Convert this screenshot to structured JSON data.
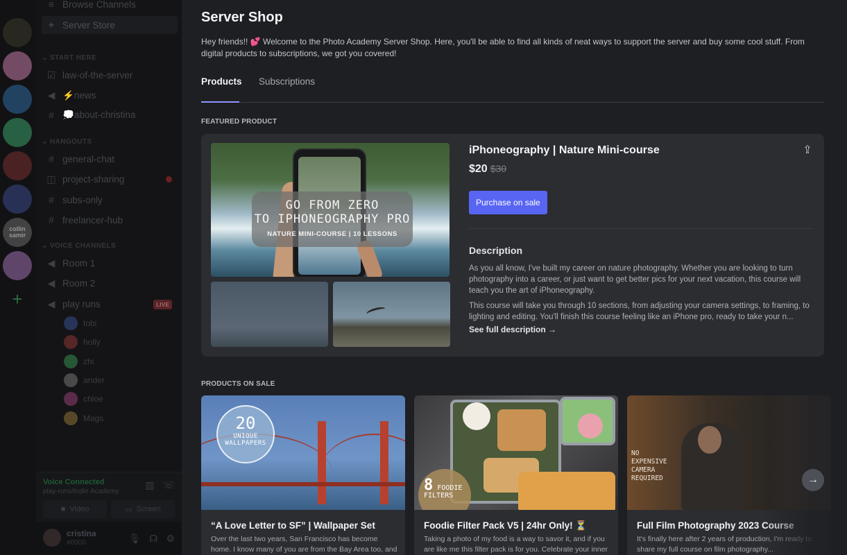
{
  "sidebar": {
    "channels_top": [
      {
        "name": "Browse Channels",
        "icon": "browse-icon"
      },
      {
        "name": "Server Store",
        "icon": "store-icon",
        "active": true
      }
    ],
    "start_here": {
      "label": "START HERE",
      "channels": [
        {
          "name": "law-of-the-server",
          "icon": "checkbox-icon"
        },
        {
          "name": "⚡news",
          "icon": "megaphone-icon"
        },
        {
          "name": "💭about-christina",
          "icon": "hash-icon"
        }
      ]
    },
    "hangouts": {
      "label": "HANGOUTS",
      "channels": [
        {
          "name": "general-chat",
          "icon": "hash-icon"
        },
        {
          "name": "project-sharing",
          "icon": "forum-icon"
        },
        {
          "name": "subs-only",
          "icon": "hash-icon"
        },
        {
          "name": "freelancer-hub",
          "icon": "hash-icon"
        }
      ]
    },
    "voice": {
      "label": "VOICE CHANNELS",
      "channels": [
        {
          "name": "Room 1",
          "icon": "speaker-icon"
        },
        {
          "name": "Room 2",
          "icon": "speaker-icon"
        },
        {
          "name": "play runs",
          "icon": "speaker-icon",
          "badge": "LIVE"
        }
      ],
      "users": [
        "tobi",
        "holly",
        "zhi",
        "ander",
        "chloe",
        "Mags"
      ]
    },
    "voice_panel": {
      "status": "Voice Connected",
      "sub": "play-runs/Indie Academy",
      "video_label": "Video",
      "screen_label": "Screen"
    },
    "user": {
      "name": "cristina",
      "tag": "#0000"
    }
  },
  "servers": {
    "badge_text": "collin samir"
  },
  "main": {
    "title": "Server Shop",
    "intro": "Hey friends!! 💕 Welcome to the Photo Academy Server Shop. Here, you'll be able to find all kinds of neat ways to support the server and buy some cool stuff. From digital products to subscriptions, we got you covered!",
    "tabs": [
      {
        "label": "Products",
        "active": true
      },
      {
        "label": "Subscriptions",
        "active": false
      }
    ],
    "featured_label": "FEATURED PRODUCT",
    "featured": {
      "overlay_l1": "GO FROM ZERO",
      "overlay_l2": "TO IPHONEOGRAPHY PRO",
      "overlay_l3": "NATURE MINI-COURSE | 10 LESSONS",
      "name": "iPhoneography | Nature Mini-course",
      "price": "$20",
      "old_price": "$30",
      "buy_label": "Purchase on sale",
      "desc_heading": "Description",
      "desc_p1": "As you all know, I've built my career on nature photography. Whether you are looking to turn photography into a career, or just want to get better pics for your next vacation, this course will teach you the art of iPhoneography.",
      "desc_p2": "This course will take you through 10 sections, from adjusting your camera settings, to framing, to lighting and editing. You'll finish this course feeling like an iPhone pro, ready to take your n...",
      "see_more": "See full description"
    },
    "sale_label": "PRODUCTS ON SALE",
    "products": [
      {
        "title": "“A Love Letter to SF” | Wallpaper Set",
        "desc": "Over the last two years, San Francisco has become home. I know many of you are from the Bay Area too, and this set of...",
        "badge_num": "20",
        "badge_text": "UNIQUE WALLPAPERS"
      },
      {
        "title": "Foodie Filter Pack V5 | 24hr Only! ⏳",
        "desc": "Taking a photo of my food is a way to savor it, and if you are like me this filter pack is for you. Celebrate your inner foodie.",
        "badge_num": "8",
        "badge_text": "FOODIE FILTERS"
      },
      {
        "title": "Full Film Photography 2023 Course",
        "desc": "It's finally here after 2 years of production, I'm ready to share my full course on film photography...",
        "badge_text": "NO EXPENSIVE CAMERA REQUIRED"
      }
    ]
  },
  "colors": {
    "accent": "#5865f2",
    "tab_underline": "#8f96ff",
    "live": "#5a2326"
  }
}
